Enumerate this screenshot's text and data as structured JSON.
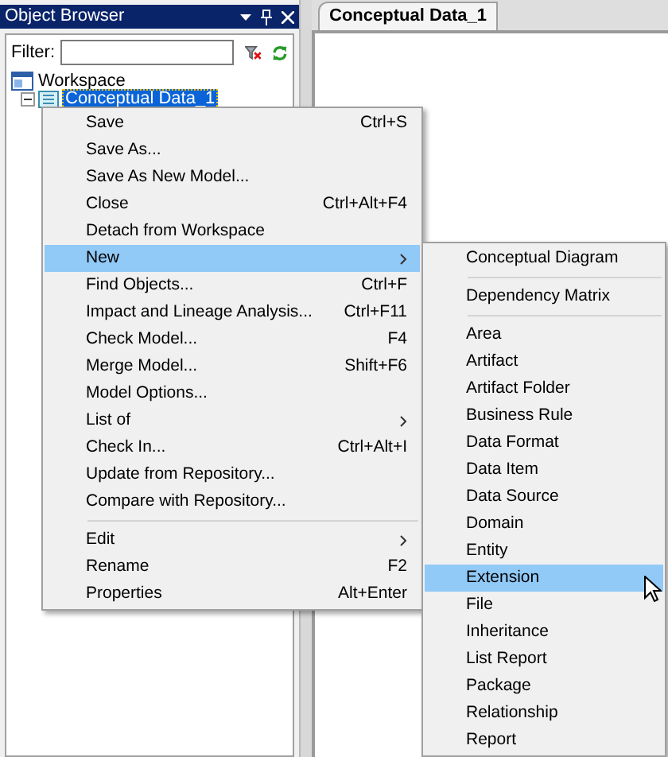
{
  "panel": {
    "title": "Object Browser",
    "filter": {
      "label": "Filter:"
    },
    "tree": [
      {
        "label": "Workspace",
        "selected": false,
        "expanded": true,
        "children": [
          {
            "label": "Conceptual Data_1",
            "selected": true,
            "expanded": true
          }
        ]
      }
    ]
  },
  "tabs": [
    {
      "label": "Conceptual Data_1",
      "selected": true
    }
  ],
  "context_menu": [
    {
      "kind": "item",
      "label": "Save",
      "shortcut": "Ctrl+S",
      "submenu": false,
      "selected": false
    },
    {
      "kind": "item",
      "label": "Save As...",
      "submenu": false,
      "selected": false
    },
    {
      "kind": "item",
      "label": "Save As New Model...",
      "submenu": false,
      "selected": false
    },
    {
      "kind": "item",
      "label": "Close",
      "shortcut": "Ctrl+Alt+F4",
      "submenu": false,
      "selected": false
    },
    {
      "kind": "item",
      "label": "Detach from Workspace",
      "submenu": false,
      "selected": false
    },
    {
      "kind": "item",
      "label": "New",
      "submenu": true,
      "selected": true
    },
    {
      "kind": "item",
      "label": "Find Objects...",
      "shortcut": "Ctrl+F",
      "submenu": false,
      "selected": false
    },
    {
      "kind": "item",
      "label": "Impact and Lineage Analysis...",
      "shortcut": "Ctrl+F11",
      "submenu": false,
      "selected": false
    },
    {
      "kind": "item",
      "label": "Check Model...",
      "shortcut": "F4",
      "submenu": false,
      "selected": false
    },
    {
      "kind": "item",
      "label": "Merge Model...",
      "shortcut": "Shift+F6",
      "submenu": false,
      "selected": false
    },
    {
      "kind": "item",
      "label": "Model Options...",
      "submenu": false,
      "selected": false
    },
    {
      "kind": "item",
      "label": "List of",
      "submenu": true,
      "selected": false
    },
    {
      "kind": "item",
      "label": "Check In...",
      "shortcut": "Ctrl+Alt+I",
      "submenu": false,
      "selected": false
    },
    {
      "kind": "item",
      "label": "Update from Repository...",
      "submenu": false,
      "selected": false
    },
    {
      "kind": "item",
      "label": "Compare with Repository...",
      "submenu": false,
      "selected": false
    },
    {
      "kind": "separator"
    },
    {
      "kind": "item",
      "label": "Edit",
      "submenu": true,
      "selected": false
    },
    {
      "kind": "item",
      "label": "Rename",
      "shortcut": "F2",
      "submenu": false,
      "selected": false
    },
    {
      "kind": "item",
      "label": "Properties",
      "shortcut": "Alt+Enter",
      "submenu": false,
      "selected": false
    }
  ],
  "submenu": [
    {
      "kind": "item",
      "label": "Conceptual Diagram",
      "selected": false
    },
    {
      "kind": "separator"
    },
    {
      "kind": "item",
      "label": "Dependency Matrix",
      "selected": false
    },
    {
      "kind": "separator"
    },
    {
      "kind": "item",
      "label": "Area",
      "selected": false
    },
    {
      "kind": "item",
      "label": "Artifact",
      "selected": false
    },
    {
      "kind": "item",
      "label": "Artifact Folder",
      "selected": false
    },
    {
      "kind": "item",
      "label": "Business Rule",
      "selected": false
    },
    {
      "kind": "item",
      "label": "Data Format",
      "selected": false
    },
    {
      "kind": "item",
      "label": "Data Item",
      "selected": false
    },
    {
      "kind": "item",
      "label": "Data Source",
      "selected": false
    },
    {
      "kind": "item",
      "label": "Domain",
      "selected": false
    },
    {
      "kind": "item",
      "label": "Entity",
      "selected": false
    },
    {
      "kind": "item",
      "label": "Extension",
      "selected": true
    },
    {
      "kind": "item",
      "label": "File",
      "selected": false
    },
    {
      "kind": "item",
      "label": "Inheritance",
      "selected": false
    },
    {
      "kind": "item",
      "label": "List Report",
      "selected": false
    },
    {
      "kind": "item",
      "label": "Package",
      "selected": false
    },
    {
      "kind": "item",
      "label": "Relationship",
      "selected": false
    },
    {
      "kind": "item",
      "label": "Report",
      "selected": false
    }
  ]
}
